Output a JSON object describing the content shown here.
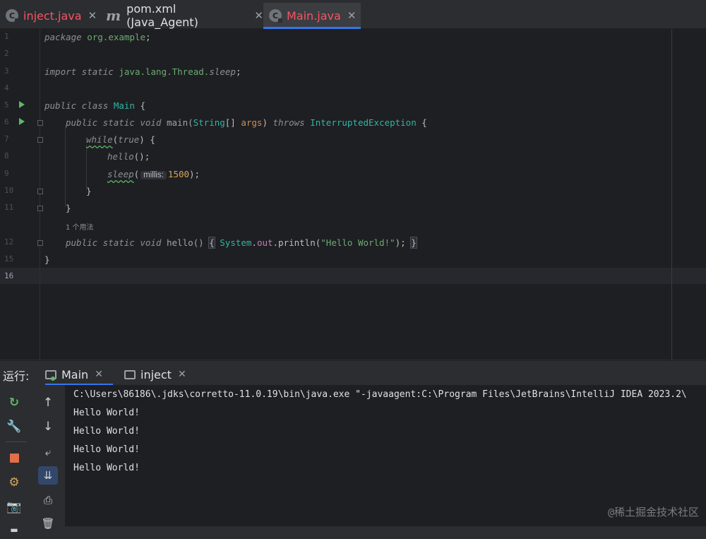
{
  "tabs": [
    {
      "label": "inject.java",
      "icon": "java-class-icon"
    },
    {
      "label": "pom.xml (Java_Agent)",
      "icon": "maven-icon"
    },
    {
      "label": "Main.java",
      "icon": "java-class-icon",
      "active": true
    }
  ],
  "editor": {
    "lines": {
      "l1": "1",
      "l2": "2",
      "l3": "3",
      "l4": "4",
      "l5": "5",
      "l6": "6",
      "l7": "7",
      "l8": "8",
      "l9": "9",
      "l10": "10",
      "l11": "11",
      "l12": "12",
      "l15": "15",
      "l16": "16"
    },
    "code": {
      "package_kw": "package",
      "package_name": "org.example",
      "semicolon": ";",
      "import_kw": "import static",
      "import_pkg": "java.lang.Thread.",
      "import_member": "sleep",
      "class_decl_kw": "public class",
      "class_name": "Main",
      "open_brace": " {",
      "main_kw": "public static void",
      "main_sig": " main(",
      "string_type": "String",
      "args_open": "[] ",
      "args": "args",
      "args_close": ") ",
      "throws_kw": "throws",
      "exception": "InterruptedException",
      "while_kw": "while",
      "while_cond_open": "(",
      "true_kw": "true",
      "while_cond_close": ") {",
      "hello_call": "hello",
      "hello_parens": "();",
      "sleep_call": "sleep",
      "sleep_open": "(",
      "param_hint": "millis:",
      "sleep_value": "1500",
      "sleep_close": ");",
      "close_brace": "}",
      "hello_kw": "public static void",
      "hello_sig": " hello() ",
      "hello_body_open": "{",
      "system": "System",
      "dot": ".",
      "out": "out",
      "println": ".println(",
      "hello_str": "\"Hello World!\"",
      "println_close": "); ",
      "hello_body_close": "}"
    },
    "usages_hint": "1 个用法"
  },
  "run_panel": {
    "title": "运行:",
    "tabs": [
      {
        "label": "Main",
        "active": true
      },
      {
        "label": "inject",
        "active": false
      }
    ],
    "console_lines": [
      "C:\\Users\\86186\\.jdks\\corretto-11.0.19\\bin\\java.exe \"-javaagent:C:\\Program Files\\JetBrains\\IntelliJ IDEA 2023.2\\",
      "Hello World!",
      "Hello World!",
      "Hello World!",
      "Hello World!"
    ]
  },
  "watermark": "@稀土掘金技术社区",
  "colors": {
    "accent": "#3574f0",
    "run_green": "#5fb865",
    "error_red": "#f75464",
    "stop_orange": "#e26e4a"
  }
}
